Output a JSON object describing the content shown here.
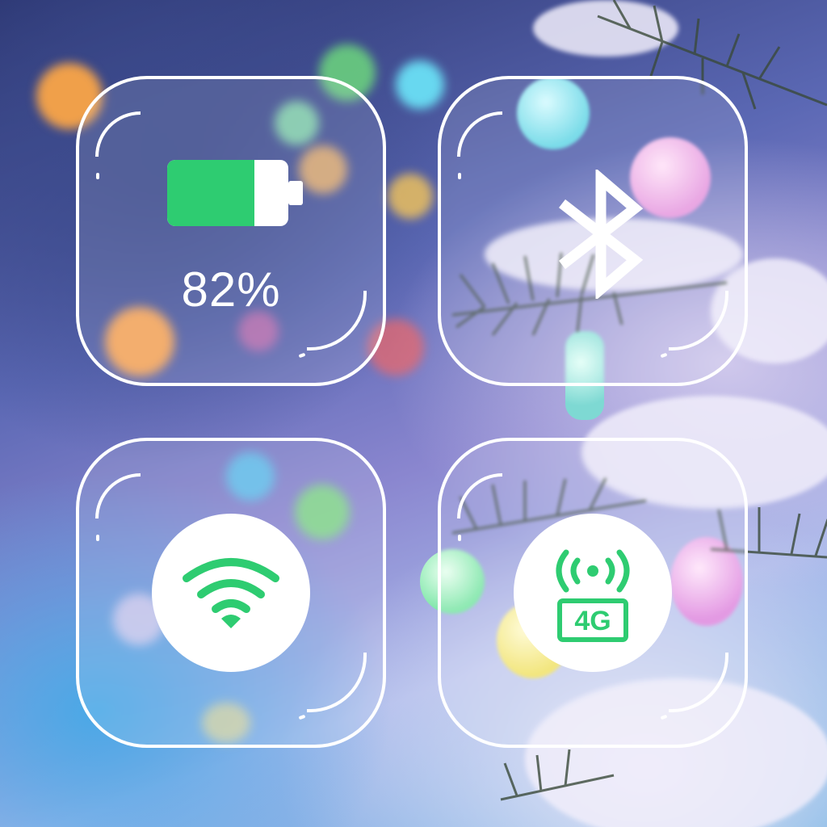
{
  "battery": {
    "percent_text": "82%",
    "level": 0.72,
    "color": "#2ecc71"
  },
  "bluetooth": {
    "icon": "bluetooth-icon"
  },
  "wifi": {
    "icon": "wifi-icon",
    "color": "#2ecc71"
  },
  "cellular": {
    "icon": "cellular-4g-icon",
    "label": "4G",
    "color": "#2ecc71"
  },
  "colors": {
    "tile_border": "#ffffff",
    "accent": "#2ecc71"
  }
}
